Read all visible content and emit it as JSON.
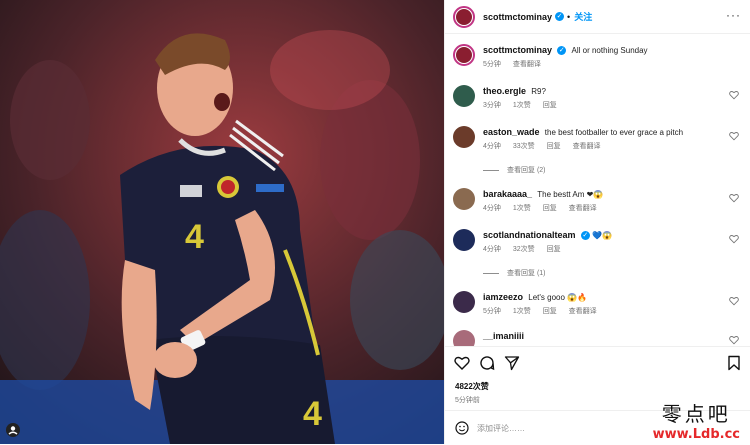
{
  "post_author": {
    "username": "scottmctominay",
    "follow_label": "关注"
  },
  "caption": {
    "username": "scottmctominay",
    "text": "All or nothing Sunday",
    "time": "5分钟",
    "translate": "查看翻译"
  },
  "comments": [
    {
      "username": "theo.ergle",
      "text": "R9?",
      "time": "3分钟",
      "likes": "1次赞",
      "reply": "回复",
      "translate": "",
      "avatar_color": "#2f5c4c"
    },
    {
      "username": "easton_wade",
      "text": "the best footballer to ever grace a pitch",
      "time": "4分钟",
      "likes": "33次赞",
      "reply": "回复",
      "translate": "查看翻译",
      "view_replies": "查看回复 (2)",
      "avatar_color": "#6b3b2a"
    },
    {
      "username": "barakaaaa_",
      "text": "The bestt Am",
      "emoji": "❤😱",
      "time": "4分钟",
      "likes": "1次赞",
      "reply": "回复",
      "translate": "查看翻译",
      "avatar_color": "#8a6a50"
    },
    {
      "username": "scotlandnationalteam",
      "text": "",
      "emoji": "💙😱",
      "time": "4分钟",
      "likes": "32次赞",
      "reply": "回复",
      "translate": "",
      "view_replies": "查看回复 (1)",
      "avatar_color": "#1d2b5a"
    },
    {
      "username": "iamzeezo",
      "text": "Let's gooo",
      "emoji": "😱🔥",
      "time": "5分钟",
      "likes": "1次赞",
      "reply": "回复",
      "translate": "查看翻译",
      "avatar_color": "#3b2a4a"
    },
    {
      "username": "__imaniiii",
      "text": "",
      "time": "",
      "likes": "",
      "reply": "",
      "translate": "",
      "avatar_color": "#a86b7a"
    }
  ],
  "actions": {
    "likes": "4822次赞",
    "time": "5分钟前"
  },
  "add_comment": {
    "placeholder": "添加评论……"
  },
  "watermark": {
    "line1": "零点吧",
    "line2": "www.Ldb.cc"
  },
  "colors": {
    "accent": "#0095f6",
    "heart": "#ed4956",
    "jersey": "#1c1f3a",
    "jersey_trim": "#d8c838"
  }
}
